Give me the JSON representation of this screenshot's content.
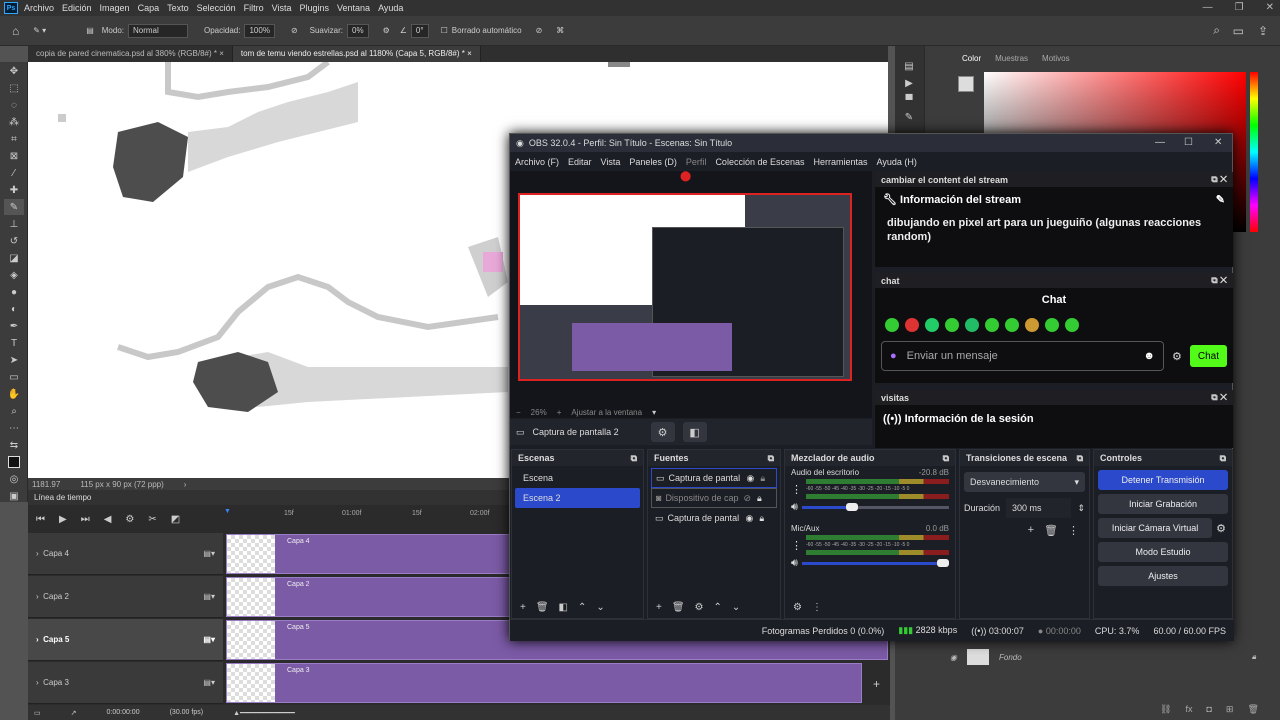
{
  "photoshop": {
    "menu": [
      "Archivo",
      "Edición",
      "Imagen",
      "Capa",
      "Texto",
      "Selección",
      "Filtro",
      "Vista",
      "Plugins",
      "Ventana",
      "Ayuda"
    ],
    "options": {
      "mode_label": "Modo:",
      "mode_value": "Normal",
      "opacity_label": "Opacidad:",
      "opacity_value": "100%",
      "smooth_label": "Suavizar:",
      "smooth_value": "0%",
      "angle_value": "0°",
      "auto_erase": "Borrado automático"
    },
    "tabs": [
      "copia de pared cinematica.psd al 380% (RGB/8#) *",
      "tom de temu viendo estrellas.psd al 1180% (Capa 5, RGB/8#) *"
    ],
    "status": {
      "zoom": "1181.97",
      "size": "115 px x 90 px (72 ppp)"
    },
    "color_panel_tabs": [
      "Color",
      "Muestras",
      "Motivos"
    ],
    "timeline": {
      "title": "Línea de tiempo",
      "ruler": [
        "15f",
        "01:00f",
        "15f",
        "02:00f"
      ],
      "layers": [
        {
          "name": "Capa 4",
          "clip": "Capa 4"
        },
        {
          "name": "Capa 2",
          "clip": "Capa 2"
        },
        {
          "name": "Capa 5",
          "clip": "Capa 5"
        },
        {
          "name": "Capa 3",
          "clip": "Capa 3"
        }
      ],
      "time": "0:00:00:00",
      "fps": "(30.00 fps)"
    },
    "layers_panel": {
      "item": "Fondo"
    }
  },
  "obs": {
    "title": "OBS 32.0.4 - Perfil: Sin Título - Escenas: Sin Título",
    "menu": [
      "Archivo (F)",
      "Editar",
      "Vista",
      "Paneles (D)",
      "Perfil",
      "Colección de Escenas",
      "Herramientas",
      "Ayuda (H)"
    ],
    "zoom": {
      "value": "26%",
      "fit": "Ajustar a la ventana"
    },
    "source_name": "Captura de pantalla 2",
    "scenes": {
      "title": "Escenas",
      "items": [
        "Escena",
        "Escena 2"
      ],
      "selected": "Escena 2"
    },
    "sources": {
      "title": "Fuentes",
      "items": [
        "Captura de pantal",
        "Dispositivo de cap",
        "Captura de pantal"
      ]
    },
    "mixer": {
      "title": "Mezclador de audio",
      "channels": [
        {
          "name": "Audio del escritorio",
          "db": "-20.8 dB",
          "level": 0.38
        },
        {
          "name": "Mic/Aux",
          "db": "0.0 dB",
          "level": 1.0
        }
      ],
      "scale": "-60 -55 -50 -45 -40 -35 -30 -25 -20 -15 -10 -5 0"
    },
    "transitions": {
      "title": "Transiciones de escena",
      "type": "Desvanecimiento",
      "duration_label": "Duración",
      "duration_value": "300 ms"
    },
    "controls": {
      "title": "Controles",
      "buttons": [
        "Detener Transmisión",
        "Iniciar Grabación",
        "Iniciar Cámara Virtual",
        "Modo Estudio",
        "Ajustes"
      ]
    },
    "stream_dock": {
      "title": "cambiar el content del stream",
      "header": "Información del stream",
      "text": "dibujando en pixel art para un jueguiño (algunas reacciones random)"
    },
    "chat_dock": {
      "title": "chat",
      "header": "Chat",
      "placeholder": "Enviar un mensaje",
      "send": "Chat"
    },
    "visits_dock": {
      "title": "visitas",
      "header": "Información de la sesión"
    },
    "status": {
      "dropped": "Fotogramas Perdidos 0 (0.0%)",
      "bitrate": "2828 kbps",
      "stream_time": "03:00:07",
      "rec_time": "00:00:00",
      "cpu": "CPU: 3.7%",
      "fps": "60.00 / 60.00 FPS"
    }
  }
}
